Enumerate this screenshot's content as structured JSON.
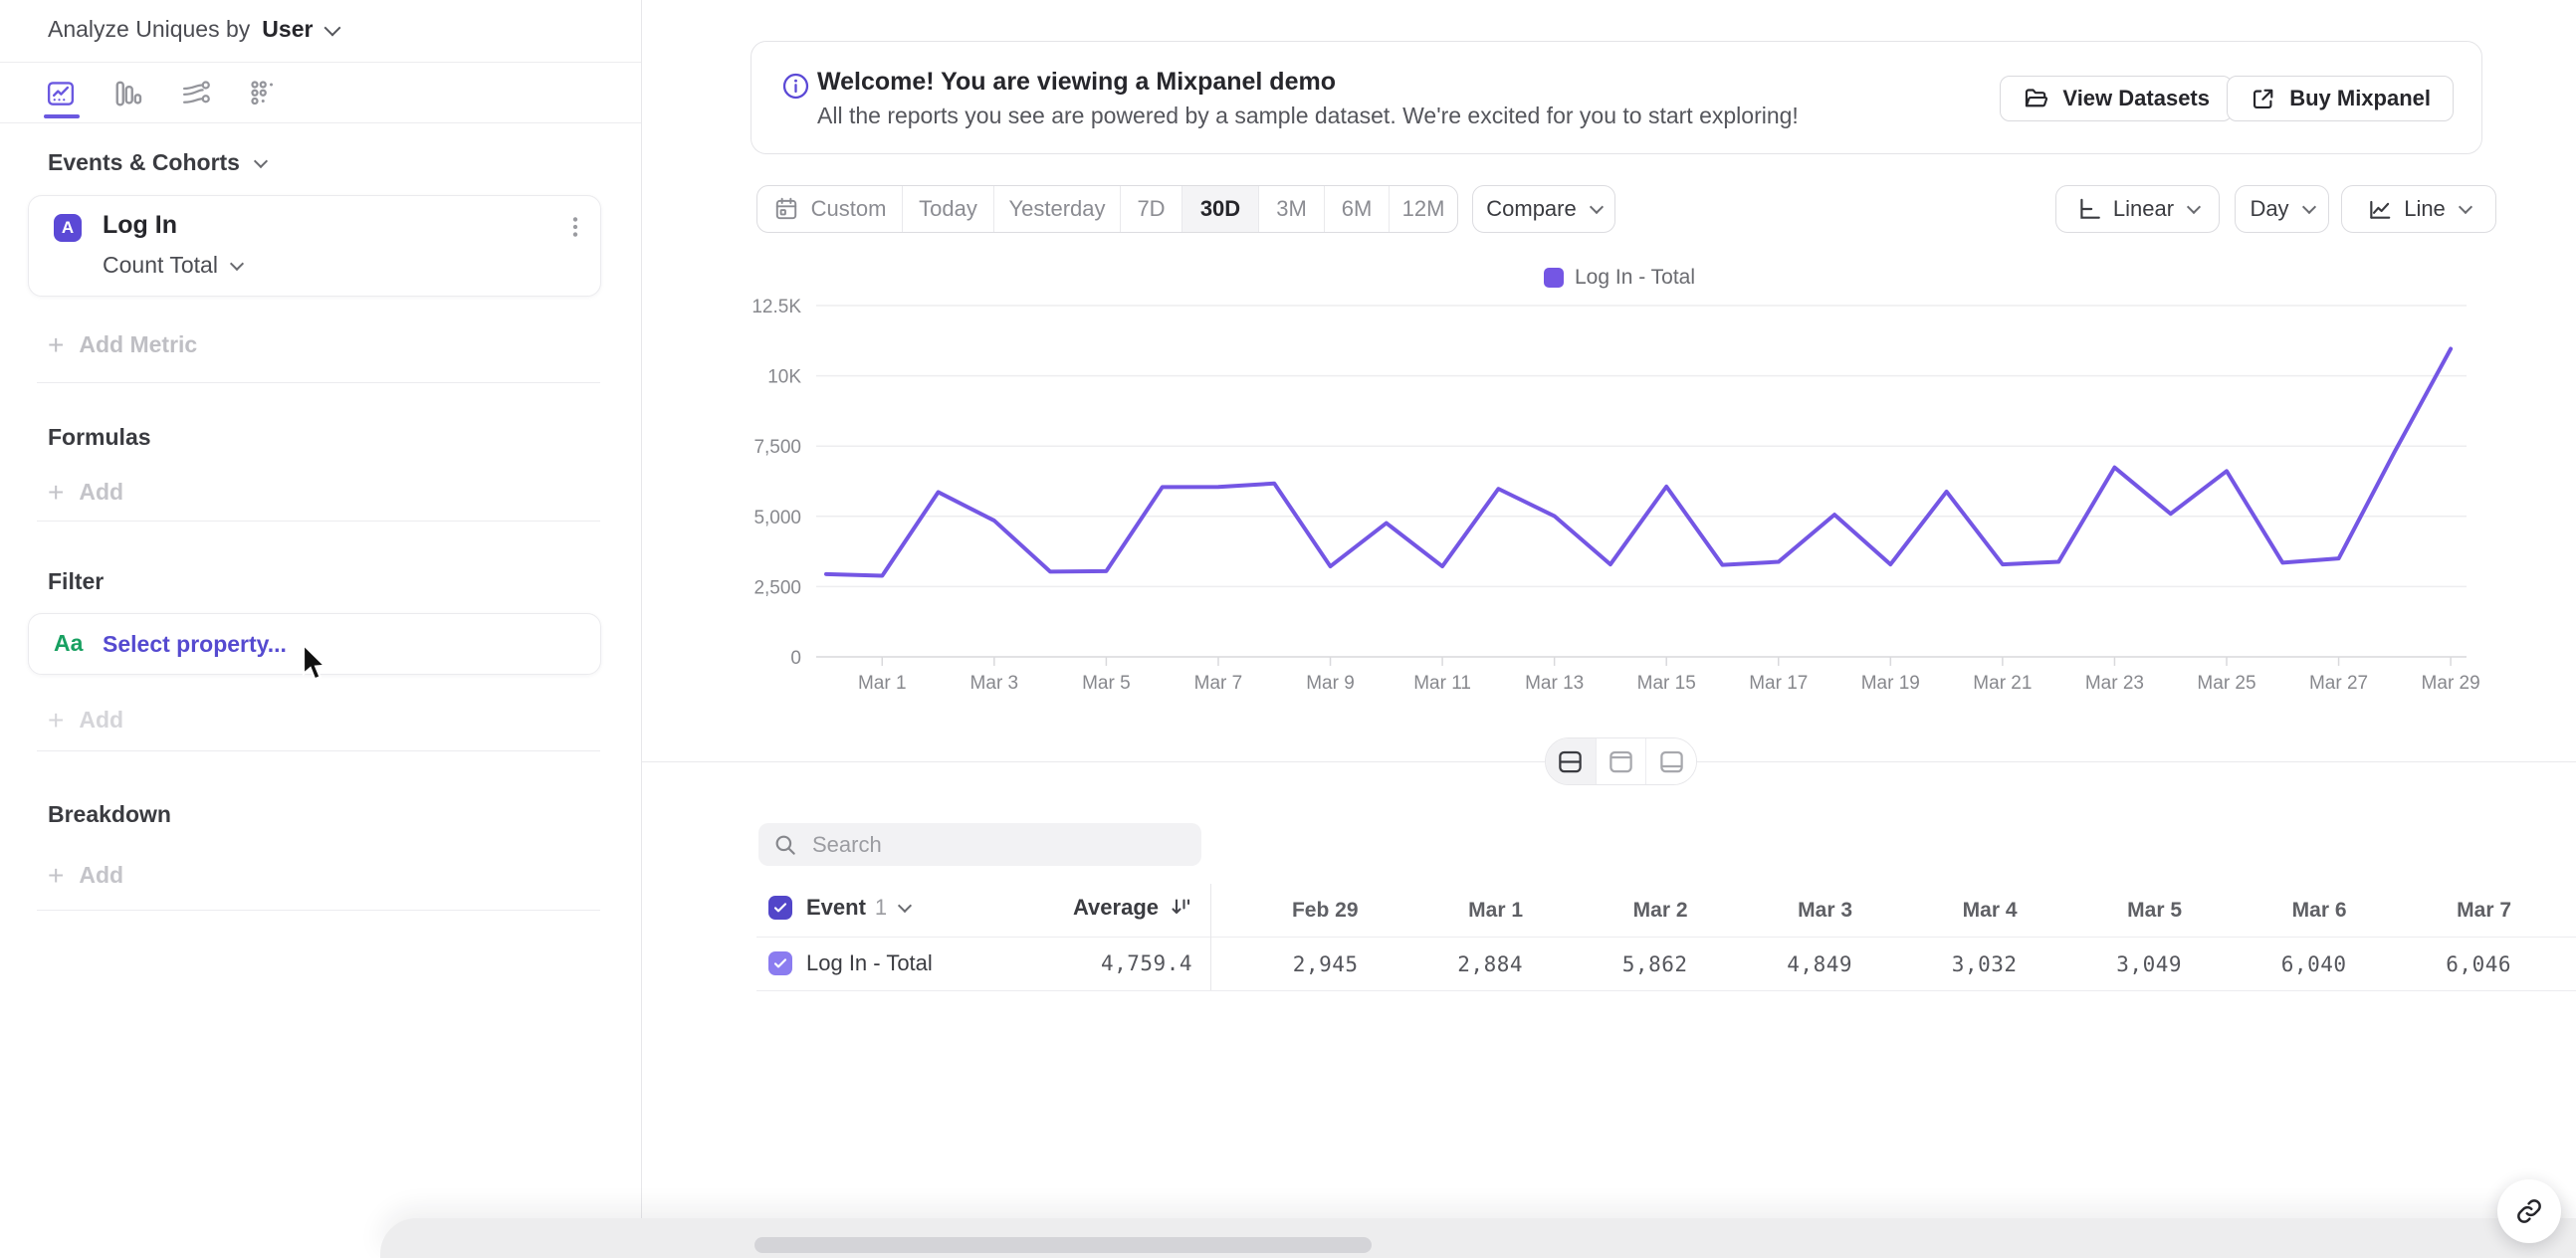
{
  "colors": {
    "accent": "#7456e4",
    "accent_dark": "#5b49d6",
    "checkbox_header": "#5246c9",
    "checkbox_row": "#8b7cf0",
    "link_text": "#554ad0",
    "property_green": "#18a061"
  },
  "sidebar": {
    "analyze_label": "Analyze Uniques by",
    "analyze_value": "User",
    "tabs": [
      "insights",
      "funnels",
      "flows",
      "retention"
    ],
    "active_tab": "insights",
    "section_events": "Events & Cohorts",
    "metric": {
      "letter": "A",
      "event": "Log In",
      "aggregation": "Count Total"
    },
    "add_metric": "Add Metric",
    "formulas_label": "Formulas",
    "formulas_add": "Add",
    "filter_label": "Filter",
    "filter_type": "Aa",
    "filter_placeholder": "Select property...",
    "filter_add": "Add",
    "breakdown_label": "Breakdown",
    "breakdown_add": "Add"
  },
  "banner": {
    "title": "Welcome! You are viewing a Mixpanel demo",
    "subtitle": "All the reports you see are powered by a sample dataset. We're excited for you to start exploring!",
    "view_datasets": "View Datasets",
    "buy_mixpanel": "Buy Mixpanel"
  },
  "toolbar": {
    "ranges": [
      "Custom",
      "Today",
      "Yesterday",
      "7D",
      "30D",
      "3M",
      "6M",
      "12M"
    ],
    "active_range": "30D",
    "compare_label": "Compare",
    "scale_label": "Linear",
    "interval_label": "Day",
    "chart_type_label": "Line"
  },
  "chart_data": {
    "type": "line",
    "title": "",
    "x": [
      "Feb 29",
      "Mar 1",
      "Mar 2",
      "Mar 3",
      "Mar 4",
      "Mar 5",
      "Mar 6",
      "Mar 7",
      "Mar 8",
      "Mar 9",
      "Mar 10",
      "Mar 11",
      "Mar 12",
      "Mar 13",
      "Mar 14",
      "Mar 15",
      "Mar 16",
      "Mar 17",
      "Mar 18",
      "Mar 19",
      "Mar 20",
      "Mar 21",
      "Mar 22",
      "Mar 23",
      "Mar 24",
      "Mar 25",
      "Mar 26",
      "Mar 27",
      "Mar 28",
      "Mar 29"
    ],
    "series": [
      {
        "name": "Log In - Total",
        "color": "#7456e4",
        "values": [
          2945,
          2884,
          5862,
          4849,
          3032,
          3049,
          6040,
          6046,
          6170,
          3220,
          4760,
          3220,
          5980,
          5010,
          3290,
          6060,
          3270,
          3380,
          5060,
          3290,
          5880,
          3290,
          3380,
          6740,
          5090,
          6610,
          3350,
          3500,
          7300,
          10960
        ]
      }
    ],
    "ylim": [
      0,
      12500
    ],
    "yticks": [
      0,
      2500,
      5000,
      7500,
      10000,
      12500
    ],
    "ytick_labels": [
      "0",
      "2,500",
      "5,000",
      "7,500",
      "10K",
      "12.5K"
    ],
    "xtick_every": 2,
    "grid": "horizontal",
    "legend_position": "top-center",
    "xlabel": "",
    "ylabel": ""
  },
  "table": {
    "search_placeholder": "Search",
    "header": {
      "event": "Event",
      "event_index": "1",
      "average": "Average"
    },
    "columns": [
      "Feb 29",
      "Mar 1",
      "Mar 2",
      "Mar 3",
      "Mar 4",
      "Mar 5",
      "Mar 6",
      "Mar 7"
    ],
    "row": {
      "label": "Log In - Total",
      "average": "4,759.4",
      "values": [
        "2,945",
        "2,884",
        "5,862",
        "4,849",
        "3,032",
        "3,049",
        "6,040",
        "6,046"
      ]
    }
  }
}
